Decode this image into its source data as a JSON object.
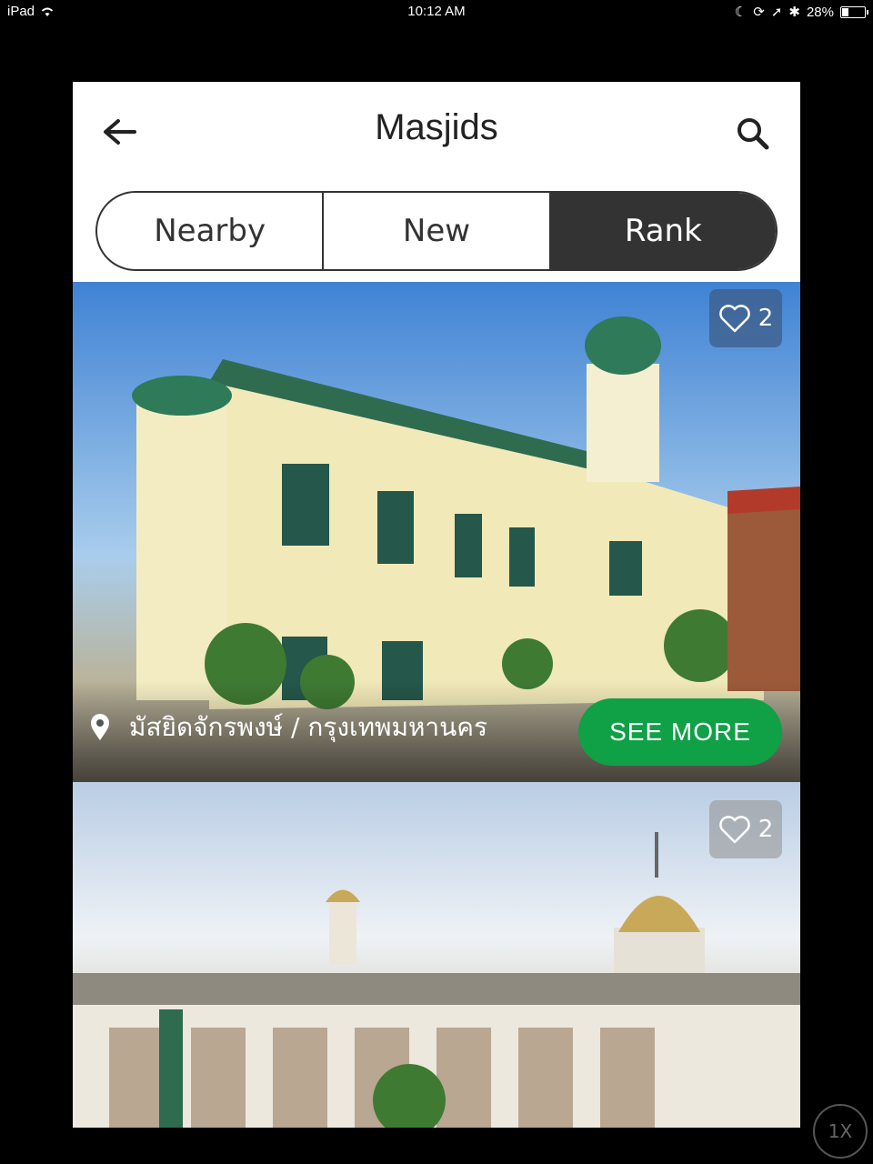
{
  "status_bar": {
    "device": "iPad",
    "time": "10:12 AM",
    "battery": "28%",
    "battery_level": 0.28
  },
  "header": {
    "title": "Masjids"
  },
  "tabs": [
    {
      "label": "Nearby",
      "active": false
    },
    {
      "label": "New",
      "active": false
    },
    {
      "label": "Rank",
      "active": true
    }
  ],
  "cards": [
    {
      "likes": "2",
      "location": "มัสยิดจักรพงษ์ / กรุงเทพมหานคร",
      "see_more": "SEE MORE"
    },
    {
      "likes": "2"
    }
  ],
  "zoom_badge": "1X",
  "colors": {
    "accent_green": "#10a046",
    "tab_active": "#333333"
  }
}
